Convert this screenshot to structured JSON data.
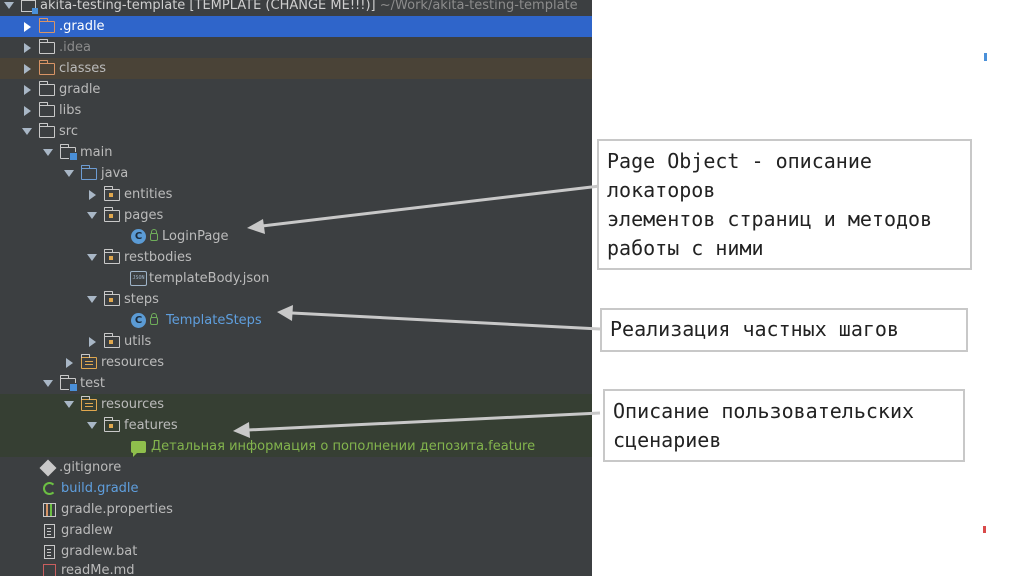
{
  "project_title": {
    "name": "akita-testing-template [TEMPLATE (CHANGE ME!!!)]",
    "path": "~/Work/akita-testing-template"
  },
  "tree": {
    "gradle_dir": ".gradle",
    "idea_dir": ".idea",
    "classes_dir": "classes",
    "gradle_folder": "gradle",
    "libs_dir": "libs",
    "src_dir": "src",
    "main_dir": "main",
    "java_dir": "java",
    "entities_dir": "entities",
    "pages_dir": "pages",
    "login_page": "LoginPage",
    "restbodies_dir": "restbodies",
    "template_body": "templateBody.json",
    "steps_dir": "steps",
    "template_steps": "TemplateSteps",
    "utils_dir": "utils",
    "main_resources": "resources",
    "test_dir": "test",
    "test_resources": "resources",
    "features_dir": "features",
    "feature_file": "Детальная информация о пополнении депозита.feature",
    "gitignore": ".gitignore",
    "build_gradle": "build.gradle",
    "gradle_properties": "gradle.properties",
    "gradlew": "gradlew",
    "gradlew_bat": "gradlew.bat",
    "readme": "readMe.md"
  },
  "icons": {
    "class_letter": "C",
    "json_badge": "JSON"
  },
  "annotations": {
    "page_object": [
      "Page Object - описание",
      "локаторов",
      "элементов страниц и методов",
      "работы с ними"
    ],
    "steps": [
      "Реализация частных шагов"
    ],
    "scenarios": [
      "Описание пользовательских",
      "сценариев"
    ]
  },
  "colors": {
    "panel_bg": "#3c3f41",
    "selection": "#2f65ca",
    "excluded_tint": "#4a4337",
    "test_tint": "#363f33",
    "link_blue": "#5f9fde",
    "feature_green": "#83b44d",
    "arrow": "#c8c8c8"
  }
}
